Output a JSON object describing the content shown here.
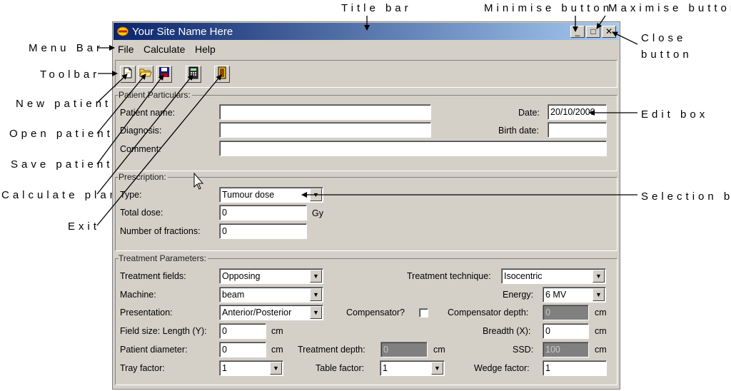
{
  "annotations": {
    "title_bar": "Title bar",
    "minimise_button": "Minimise button",
    "maximise_button": "Maximise button",
    "close_button_1": "Close",
    "close_button_2": "button",
    "menu_bar": "Menu Bar",
    "toolbar": "Toolbar",
    "new_patient": "New patient",
    "open_patient": "Open patient",
    "save_patient": "Save patient",
    "calculate_plan": "Calculate plan",
    "exit": "Exit",
    "edit_box": "Edit box",
    "selection_box": "Selection box"
  },
  "window": {
    "title": "Your Site Name Here",
    "minimise": "_",
    "maximise": "□",
    "close": "✕"
  },
  "menu": [
    "File",
    "Calculate",
    "Help"
  ],
  "toolbar_icons": [
    "new-patient",
    "open-patient",
    "save-patient",
    "calculate-plan",
    "exit"
  ],
  "patient": {
    "group_label": "Patient Particulars:",
    "name_label": "Patient name:",
    "name_value": "",
    "diagnosis_label": "Diagnosis:",
    "diagnosis_value": "",
    "comment_label": "Comment:",
    "comment_value": "",
    "date_label": "Date:",
    "date_value": "20/10/2000",
    "birth_label": "Birth date:",
    "birth_value": ""
  },
  "prescription": {
    "group_label": "Prescription:",
    "type_label": "Type:",
    "type_value": "Tumour dose",
    "total_label": "Total dose:",
    "total_value": "0",
    "total_unit": "Gy",
    "fractions_label": "Number of fractions:",
    "fractions_value": "0"
  },
  "treatment": {
    "group_label": "Treatment Parameters:",
    "fields_label": "Treatment fields:",
    "fields_value": "Opposing",
    "technique_label": "Treatment technique:",
    "technique_value": "Isocentric",
    "machine_label": "Machine:",
    "machine_value": "beam",
    "energy_label": "Energy:",
    "energy_value": "6 MV",
    "presentation_label": "Presentation:",
    "presentation_value": "Anterior/Posterior",
    "compensator_label": "Compensator?",
    "comp_depth_label": "Compensator depth:",
    "comp_depth_value": "0",
    "comp_depth_unit": "cm",
    "length_label": "Field size: Length (Y):",
    "length_value": "0",
    "length_unit": "cm",
    "breadth_label": "Breadth (X):",
    "breadth_value": "0",
    "breadth_unit": "cm",
    "diameter_label": "Patient diameter:",
    "diameter_value": "0",
    "diameter_unit": "cm",
    "tdepth_label": "Treatment depth:",
    "tdepth_value": "0",
    "tdepth_unit": "cm",
    "ssd_label": "SSD:",
    "ssd_value": "100",
    "ssd_unit": "cm",
    "tray_label": "Tray factor:",
    "tray_value": "1",
    "table_label": "Table factor:",
    "table_value": "1",
    "wedge_label": "Wedge factor:",
    "wedge_value": "1"
  }
}
